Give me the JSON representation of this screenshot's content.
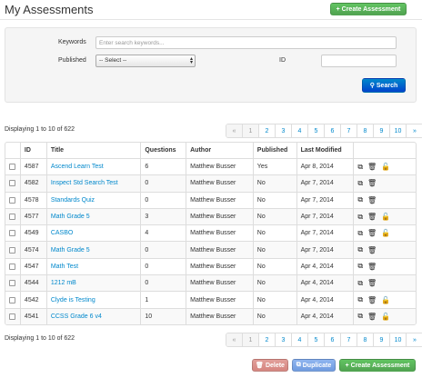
{
  "page_title": "My Assessments",
  "create_button": "+ Create Assessment",
  "search": {
    "keywords_label": "Keywords",
    "keywords_placeholder": "Enter search keywords...",
    "published_label": "Published",
    "published_value": "-- Select --",
    "id_label": "ID",
    "button": "Search"
  },
  "displaying_text": "Displaying 1 to 10 of 622",
  "pagination": [
    "«",
    "1",
    "2",
    "3",
    "4",
    "5",
    "6",
    "7",
    "8",
    "9",
    "10",
    "»"
  ],
  "columns": [
    "ID",
    "Title",
    "Questions",
    "Author",
    "Published",
    "Last Modified"
  ],
  "rows": [
    {
      "id": "4587",
      "title": "Ascend Learn Test",
      "questions": "6",
      "author": "Matthew Busser",
      "published": "Yes",
      "modified": "Apr 8, 2014",
      "locked": true
    },
    {
      "id": "4582",
      "title": "Inspect Std Search Test",
      "questions": "0",
      "author": "Matthew Busser",
      "published": "No",
      "modified": "Apr 7, 2014",
      "locked": false
    },
    {
      "id": "4578",
      "title": "Standards Quiz",
      "questions": "0",
      "author": "Matthew Busser",
      "published": "No",
      "modified": "Apr 7, 2014",
      "locked": false
    },
    {
      "id": "4577",
      "title": "Math Grade 5",
      "questions": "3",
      "author": "Matthew Busser",
      "published": "No",
      "modified": "Apr 7, 2014",
      "locked": true
    },
    {
      "id": "4549",
      "title": "CASBO",
      "questions": "4",
      "author": "Matthew Busser",
      "published": "No",
      "modified": "Apr 7, 2014",
      "locked": true
    },
    {
      "id": "4574",
      "title": "Math Grade 5",
      "questions": "0",
      "author": "Matthew Busser",
      "published": "No",
      "modified": "Apr 7, 2014",
      "locked": false
    },
    {
      "id": "4547",
      "title": "Math Test",
      "questions": "0",
      "author": "Matthew Busser",
      "published": "No",
      "modified": "Apr 4, 2014",
      "locked": false
    },
    {
      "id": "4544",
      "title": "1212 mB",
      "questions": "0",
      "author": "Matthew Busser",
      "published": "No",
      "modified": "Apr 4, 2014",
      "locked": false
    },
    {
      "id": "4542",
      "title": "Clyde is Testing",
      "questions": "1",
      "author": "Matthew Busser",
      "published": "No",
      "modified": "Apr 4, 2014",
      "locked": true
    },
    {
      "id": "4541",
      "title": "CCSS Grade 6 v4",
      "questions": "10",
      "author": "Matthew Busser",
      "published": "No",
      "modified": "Apr 4, 2014",
      "locked": true
    }
  ],
  "actions": {
    "delete": "Delete",
    "duplicate": "Duplicate"
  },
  "icons": {
    "copy": "copy-icon",
    "trash": "trash-icon",
    "lock": "lock-icon"
  },
  "colors": {
    "accent_green": "#51a351",
    "link_blue": "#0088cc",
    "search_blue": "#0044cc",
    "delete_red": "#d6857f",
    "duplicate_blue": "#6f9be0"
  }
}
